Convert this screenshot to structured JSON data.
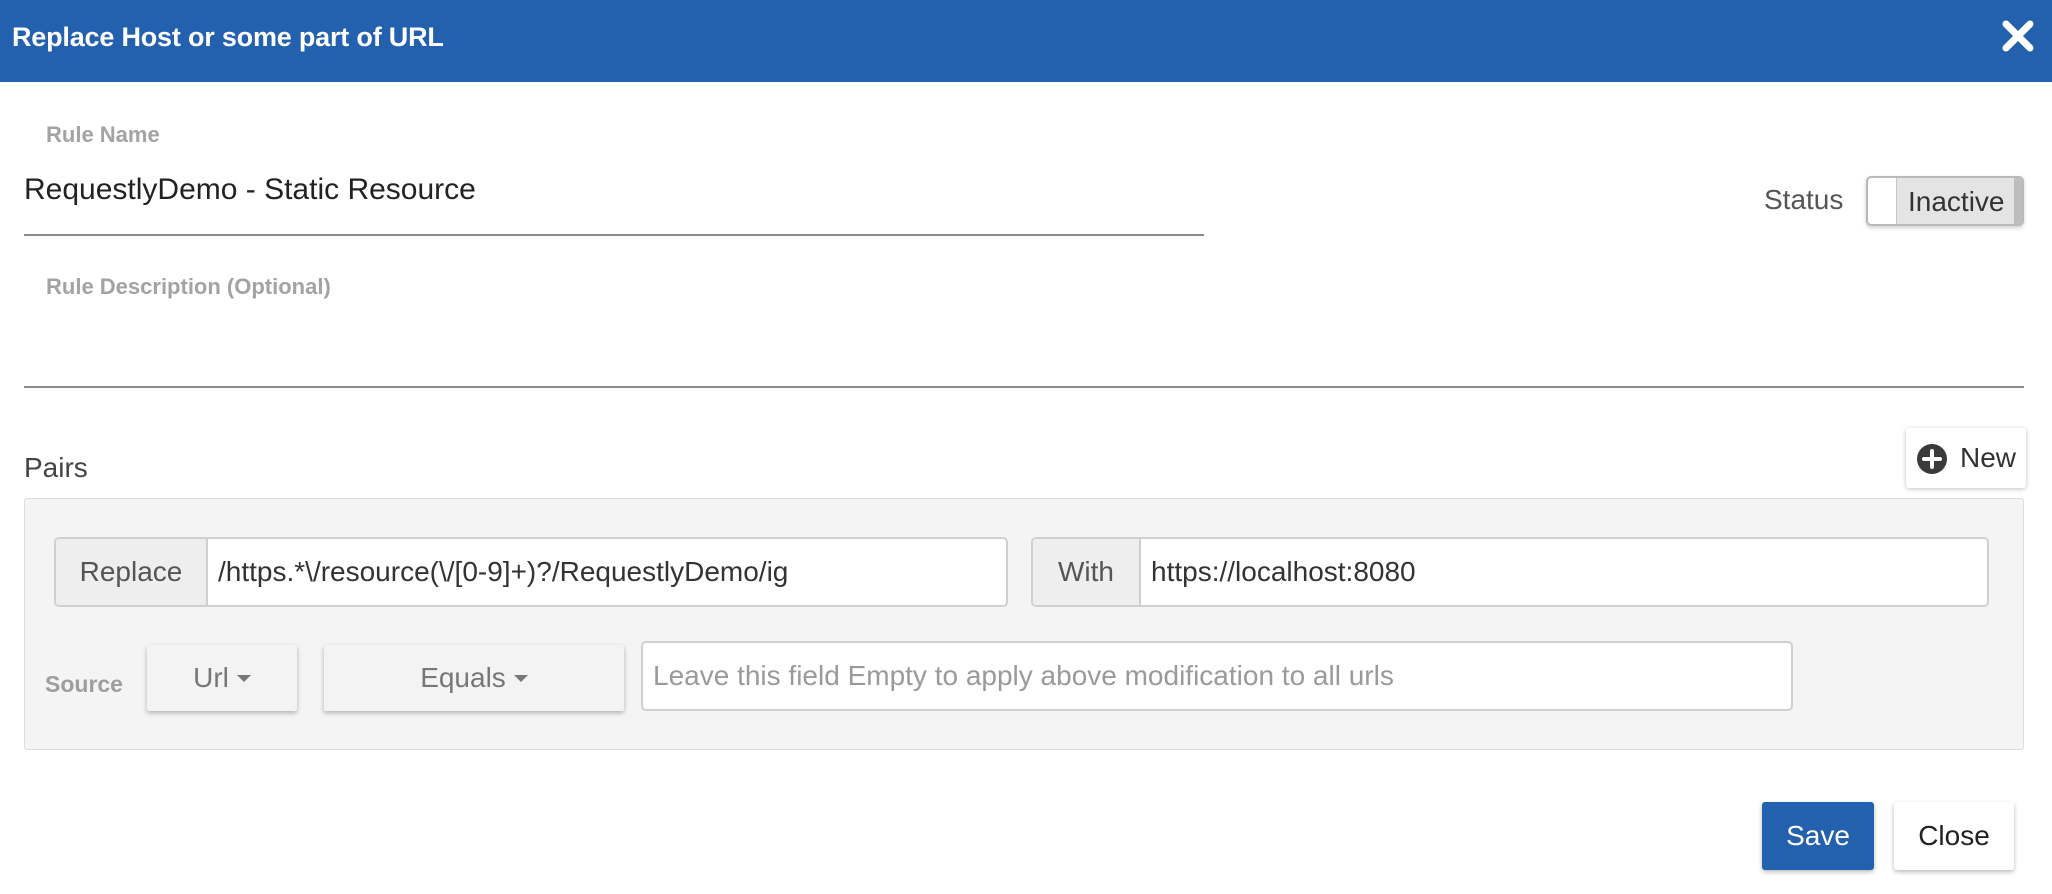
{
  "dialog": {
    "title": "Replace Host or some part of URL",
    "close_icon": "close-x-icon"
  },
  "rule_name": {
    "label": "Rule Name",
    "value": "RequestlyDemo - Static Resource"
  },
  "rule_description": {
    "label": "Rule Description (Optional)",
    "value": ""
  },
  "status": {
    "label": "Status",
    "toggle_text": "Inactive"
  },
  "pairs": {
    "title": "Pairs",
    "new_button_label": "New",
    "new_button_icon": "plus-circle-icon",
    "replace": {
      "label": "Replace",
      "value": "/https.*\\/resource(\\/[0-9]+)?/RequestlyDemo/ig"
    },
    "with": {
      "label": "With",
      "value": "https://localhost:8080"
    },
    "source": {
      "label": "Source",
      "key_selected": "Url",
      "operator_selected": "Equals",
      "value_placeholder": "Leave this field Empty to apply above modification to all urls",
      "value": ""
    }
  },
  "footer": {
    "save_label": "Save",
    "close_label": "Close"
  },
  "colors": {
    "header_bg": "#2360ae",
    "primary_button": "#2360ae"
  }
}
